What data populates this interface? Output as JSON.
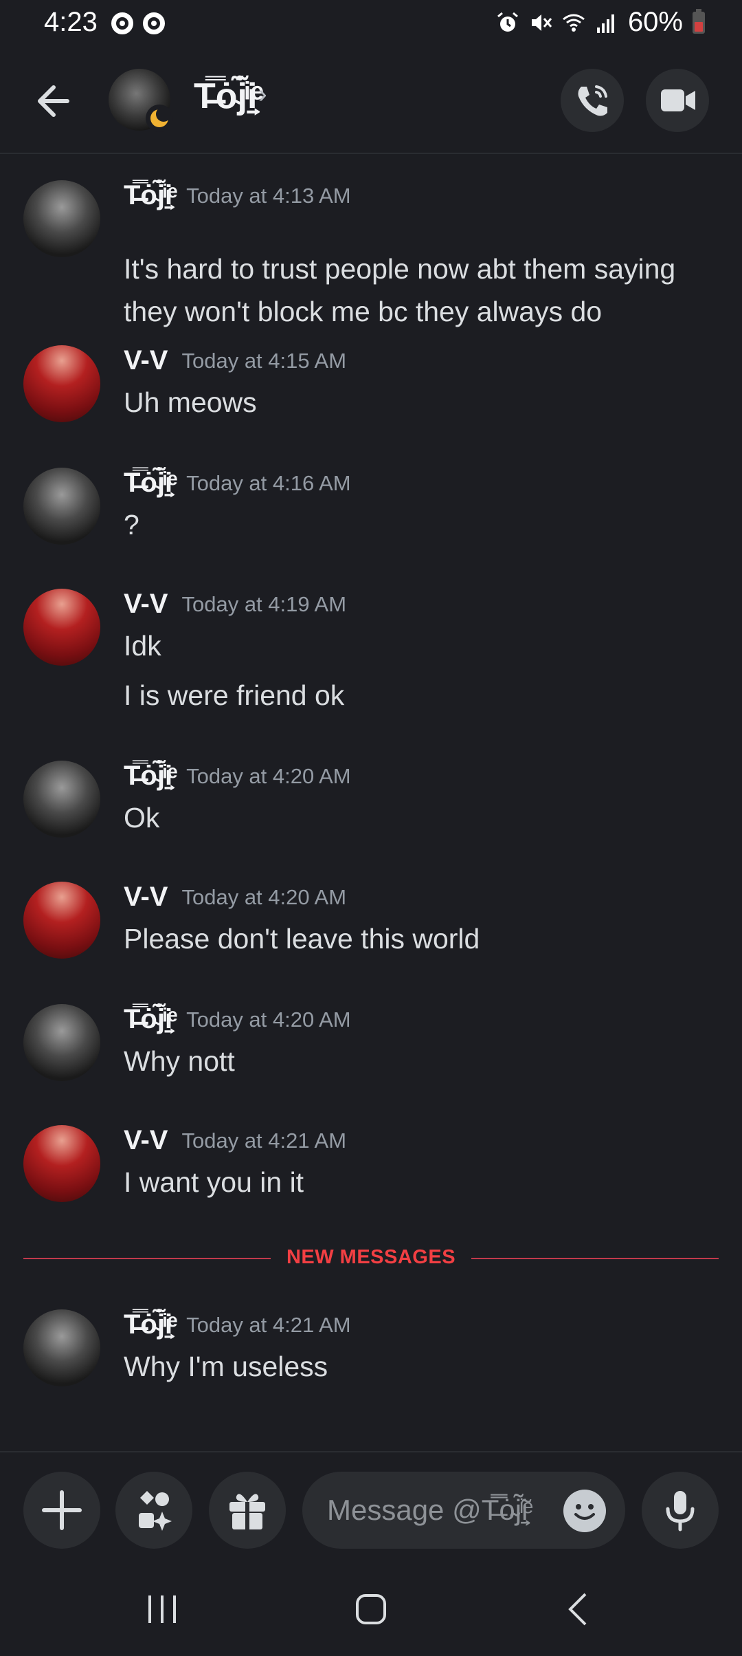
{
  "status_bar": {
    "time": "4:23",
    "battery_percent": "60%",
    "icons": [
      "notification-ring-icon",
      "notification-ring-icon",
      "alarm-icon",
      "mute-icon",
      "wifi-icon",
      "signal-icon",
      "battery-icon"
    ]
  },
  "header": {
    "channel_name": "T̶̿ȯ̴j̃̃ͥi̱͕ͤ",
    "presence": "idle",
    "icons": {
      "back": "arrow-left-icon",
      "call": "phone-icon",
      "video": "video-camera-icon"
    }
  },
  "messages": [
    {
      "author": "T̶̿ȯ̴j̃̃ͥi̱͕ͤ",
      "avatar": "toji",
      "timestamp": "Today at 4:13 AM",
      "lines": [
        "It's hard to trust people now abt them saying they won't block me bc they always do"
      ]
    },
    {
      "author": "V-V",
      "avatar": "vv",
      "timestamp": "Today at 4:15 AM",
      "lines": [
        "Uh meows"
      ]
    },
    {
      "author": "T̶̿ȯ̴j̃̃ͥi̱͕ͤ",
      "avatar": "toji",
      "timestamp": "Today at 4:16 AM",
      "lines": [
        "?"
      ]
    },
    {
      "author": "V-V",
      "avatar": "vv",
      "timestamp": "Today at 4:19 AM",
      "lines": [
        "Idk",
        "I is were friend ok"
      ]
    },
    {
      "author": "T̶̿ȯ̴j̃̃ͥi̱͕ͤ",
      "avatar": "toji",
      "timestamp": "Today at 4:20 AM",
      "lines": [
        "Ok"
      ]
    },
    {
      "author": "V-V",
      "avatar": "vv",
      "timestamp": "Today at 4:20 AM",
      "lines": [
        "Please don't leave this world"
      ]
    },
    {
      "author": "T̶̿ȯ̴j̃̃ͥi̱͕ͤ",
      "avatar": "toji",
      "timestamp": "Today at 4:20 AM",
      "lines": [
        "Why nott"
      ]
    },
    {
      "author": "V-V",
      "avatar": "vv",
      "timestamp": "Today at 4:21 AM",
      "lines": [
        "I want you in it"
      ]
    },
    {
      "author": "T̶̿ȯ̴j̃̃ͥi̱͕ͤ",
      "avatar": "toji",
      "timestamp": "Today at 4:21 AM",
      "lines": [
        "Why I'm useless"
      ]
    }
  ],
  "new_messages_divider": "NEW MESSAGES",
  "composer": {
    "placeholder": "Message @T̶̿ȯ̴j̃̃ͥi̱͕ͤ",
    "icons": {
      "add": "plus-icon",
      "apps": "apps-icon",
      "gift": "gift-icon",
      "emoji": "emoji-icon",
      "voice": "microphone-icon"
    }
  },
  "nav_bar": {
    "icons": [
      "recent-apps-icon",
      "home-icon",
      "back-icon"
    ]
  },
  "colors": {
    "background": "#1c1d22",
    "surface": "#2b2d31",
    "divider_red": "#f23f43",
    "idle_moon": "#f0b232",
    "text_primary": "#f2f3f5",
    "text_muted": "#949ba4"
  }
}
